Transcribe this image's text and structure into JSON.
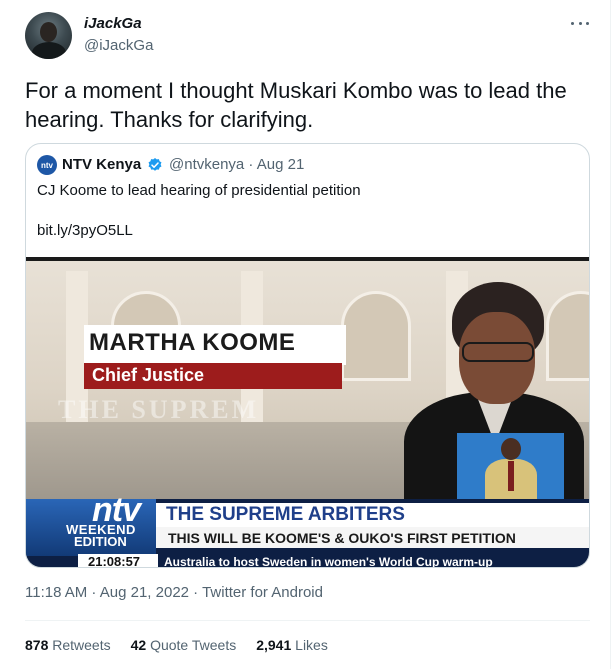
{
  "tweet": {
    "display_name": "iJackGa",
    "handle": "@iJackGa",
    "text": "For a moment I thought Muskari Kombo was to lead the hearing. Thanks for clarifying.",
    "timestamp": "11:18 AM · Aug 21, 2022 · Twitter for Android"
  },
  "quote": {
    "name": "NTV Kenya",
    "avatar_text": "ntv",
    "handle_date": "@ntvkenya · Aug 21",
    "text": "CJ Koome to lead hearing of presidential petition",
    "link": "bit.ly/3pyO5LL",
    "media": {
      "lower_third_name": "MARTHA KOOME",
      "lower_third_title": "Chief Justice",
      "watermark": "THE SUPREM",
      "logo": "ntv",
      "logo_line1": "WEEKEND",
      "logo_line2": "EDITION",
      "headline": "THE SUPREME ARBITERS",
      "subheadline": "THIS WILL BE KOOME'S & OUKO'S FIRST PETITION",
      "clock": "21:08:57",
      "crawl": "Australia to host Sweden in women's World Cup warm-up"
    }
  },
  "stats": {
    "retweets_count": "878",
    "retweets_label": "Retweets",
    "quotes_count": "42",
    "quotes_label": "Quote Tweets",
    "likes_count": "2,941",
    "likes_label": "Likes"
  },
  "icons": {
    "more": "more-icon",
    "verified": "verified-icon"
  },
  "colors": {
    "verified": "#1d9bf0",
    "secondary_text": "#536471"
  }
}
